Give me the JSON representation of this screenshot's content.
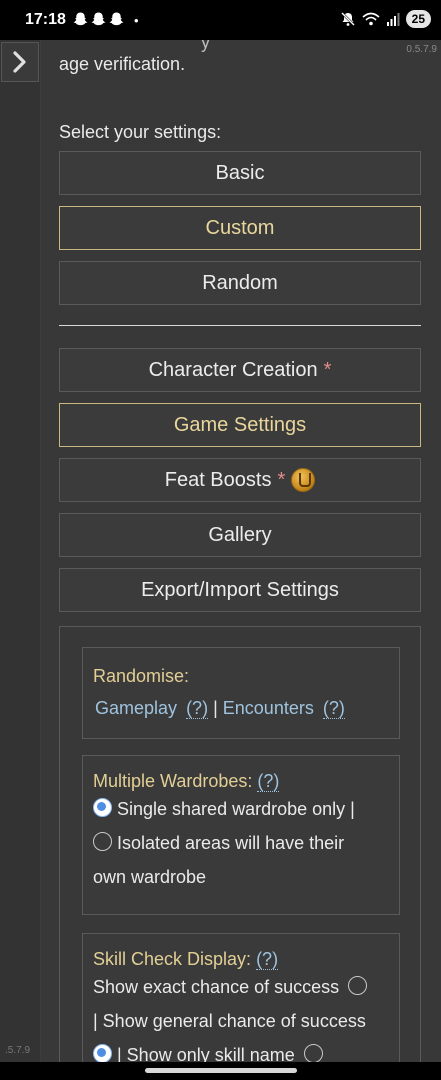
{
  "status": {
    "time": "17:18",
    "notification_dot": "•",
    "battery": "25"
  },
  "app": {
    "version": "0.5.7.9",
    "rail_version": ".5.7.9",
    "intro_cut": "y",
    "intro_text": "age verification.",
    "select_label": "Select your settings:"
  },
  "presets": [
    {
      "label": "Basic",
      "active": false
    },
    {
      "label": "Custom",
      "active": true
    },
    {
      "label": "Random",
      "active": false
    }
  ],
  "sections": {
    "character_creation": "Character Creation",
    "game_settings": "Game Settings",
    "feat_boosts": "Feat Boosts",
    "gallery": "Gallery",
    "export_import": "Export/Import Settings",
    "asterisk": "*"
  },
  "randomise": {
    "title": "Randomise:",
    "gameplay": "Gameplay",
    "encounters": "Encounters",
    "help": "(?)",
    "separator": "|"
  },
  "wardrobes": {
    "title": "Multiple Wardrobes:",
    "help": "(?)",
    "option1": "Single shared wardrobe only |",
    "option2_line1": "Isolated areas will have their",
    "option2_line2": "own wardrobe",
    "selected": "option1"
  },
  "skill_check": {
    "title": "Skill Check Display:",
    "help": "(?)",
    "option1": "Show exact chance of success",
    "option2": "| Show general chance of success",
    "option3": "| Show only skill name",
    "selected": "option3"
  },
  "colors": {
    "accent": "#c9b77e",
    "link": "#9fc3de",
    "asterisk": "#e68b8b"
  }
}
